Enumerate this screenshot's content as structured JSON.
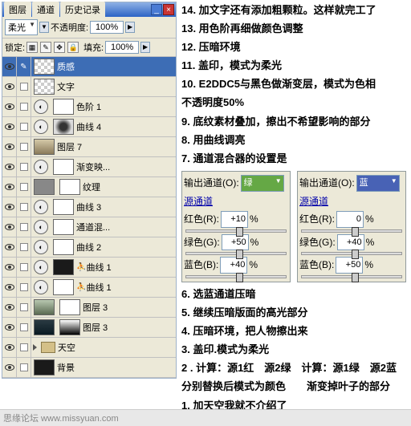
{
  "panel": {
    "tabs": [
      "图层",
      "通道",
      "历史记录"
    ],
    "blend": "柔光",
    "opacity_lbl": "不透明度:",
    "opacity": "100%",
    "lock_lbl": "锁定:",
    "fill_lbl": "填充:",
    "fill": "100%"
  },
  "layers": [
    {
      "name": "质感",
      "type": "checker",
      "sel": true
    },
    {
      "name": "文字",
      "type": "checker-only"
    },
    {
      "name": "色阶 1",
      "type": "adj"
    },
    {
      "name": "曲线 4",
      "type": "adj-circ"
    },
    {
      "name": "图层 7",
      "type": "scene1"
    },
    {
      "name": "渐变映...",
      "type": "adj"
    },
    {
      "name": "纹理",
      "type": "gray-mask"
    },
    {
      "name": "曲线 3",
      "type": "adj"
    },
    {
      "name": "通道混...",
      "type": "adj"
    },
    {
      "name": "曲线 2",
      "type": "adj"
    },
    {
      "name": "曲线 1",
      "type": "adj-person",
      "p": true
    },
    {
      "name": "曲线 1",
      "type": "adj-person2",
      "p": true
    },
    {
      "name": "图层 3",
      "type": "scene2"
    },
    {
      "name": "图层 3",
      "type": "scene3-grad"
    },
    {
      "name": "天空",
      "type": "folder"
    },
    {
      "name": "背景",
      "type": "dark-lock"
    }
  ],
  "steps": [
    "14. 加文字还有添加粗颗粒。这样就完工了",
    "13. 用色阶再细做颜色调整",
    "12. 压暗环境",
    "11. 盖印，模式为柔光",
    "10. E2DDC5与黑色做渐变层，模式为色相",
    "不透明度50%",
    "9. 底纹素材叠加，擦出不希望影响的部分",
    "8. 用曲线调亮",
    "7. 通道混合器的设置是"
  ],
  "mixer": {
    "out_lbl": "输出通道(O):",
    "src_lbl": "源通道",
    "left": {
      "sel": "绿",
      "r": "+10",
      "g": "+50",
      "b": "+40"
    },
    "right": {
      "sel": "蓝",
      "r": "0",
      "g": "+40",
      "b": "+50"
    },
    "r_lbl": "红色(R):",
    "g_lbl": "绿色(G):",
    "b_lbl": "蓝色(B):",
    "pct": "%"
  },
  "steps2": [
    "6. 选蓝通道压暗",
    "5. 继续压暗版面的高光部分",
    "4. 压暗环境，把人物擦出来",
    "3. 盖印.模式为柔光",
    "2 . 计算：源1红　源2绿　计算：源1绿　源2蓝",
    "分别替换后模式为颜色　　渐变掉叶子的部分",
    "1. 加天空我就不介绍了"
  ],
  "footer": "思缘论坛  www.missyuan.com"
}
